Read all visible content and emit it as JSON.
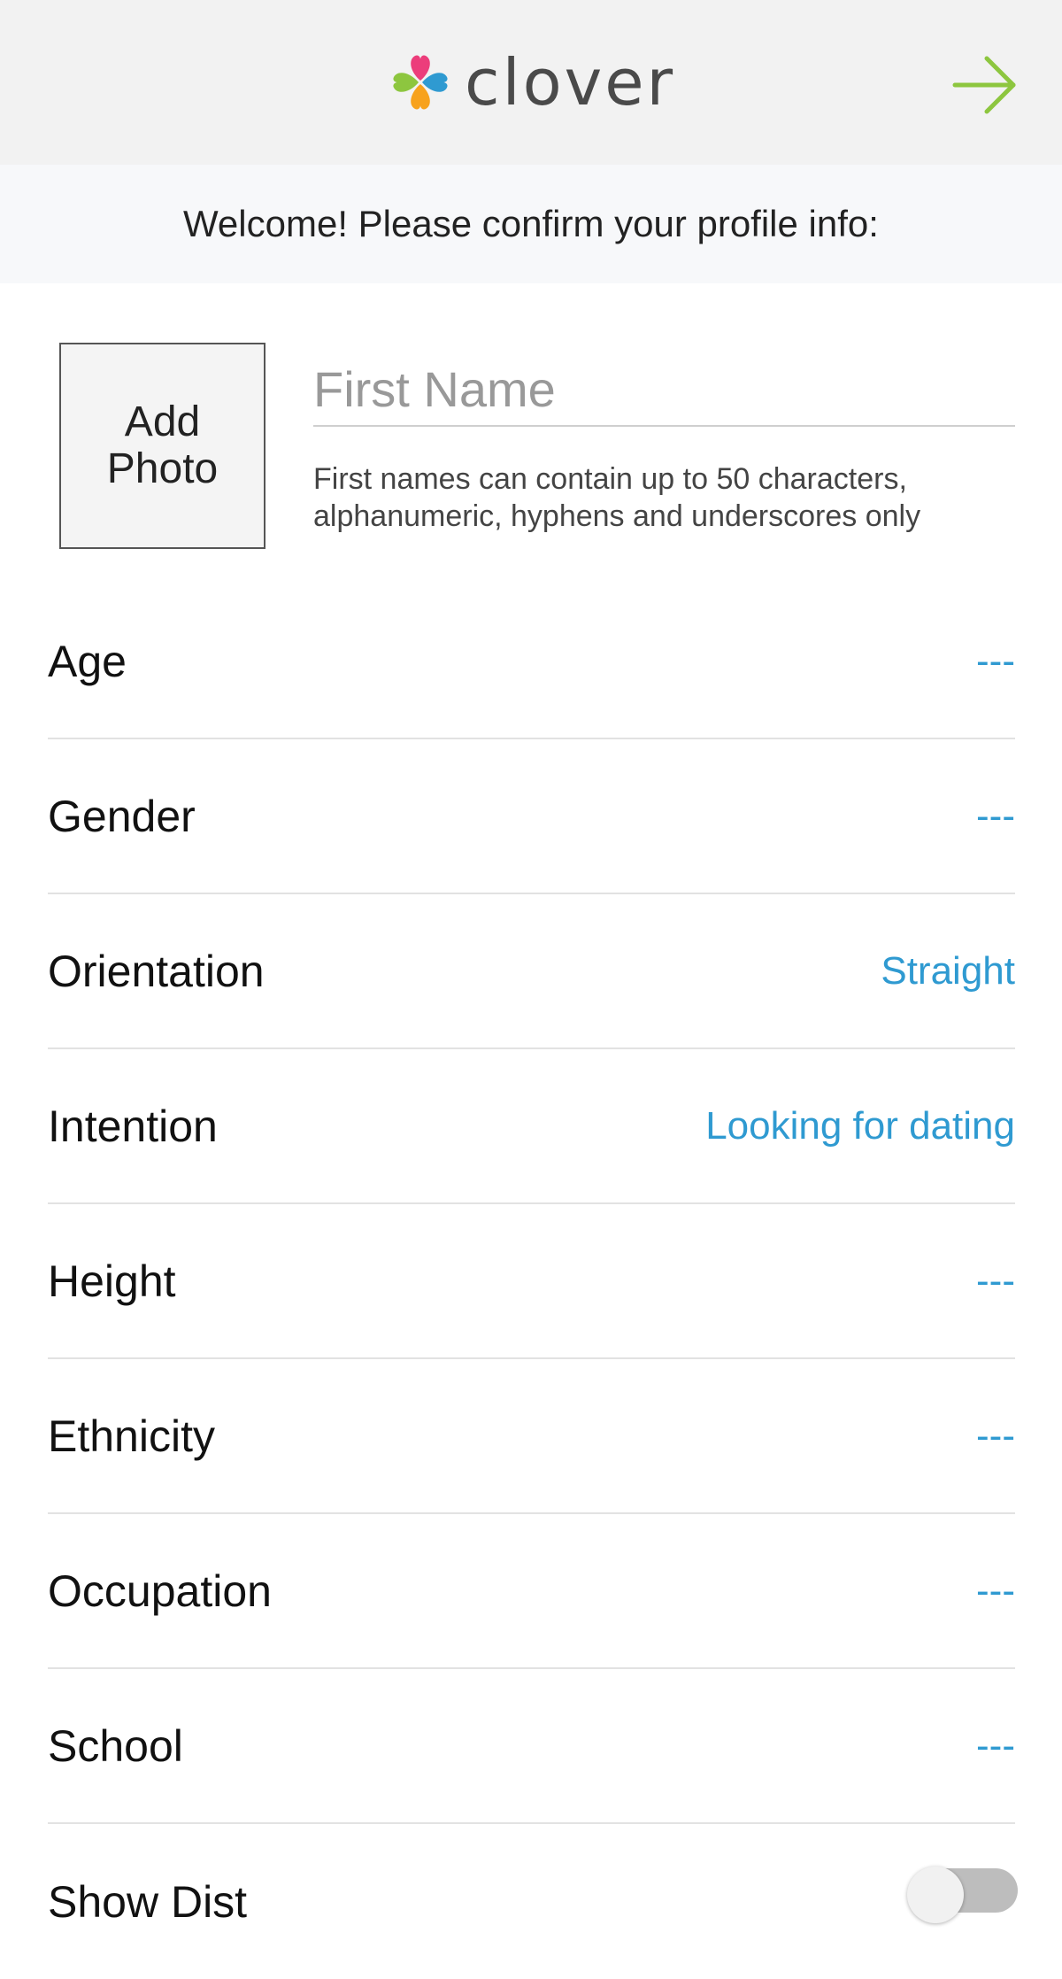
{
  "header": {
    "logo_text": "clover",
    "next_icon": "arrow-right-icon",
    "accent_color": "#8dc63f"
  },
  "welcome": {
    "text": "Welcome! Please confirm your profile info:"
  },
  "photo": {
    "label_line1": "Add",
    "label_line2": "Photo"
  },
  "name": {
    "placeholder": "First Name",
    "value": "",
    "helper_line1": "First names can contain up to 50 characters,",
    "helper_line2": "alphanumeric, hyphens and underscores only"
  },
  "fields": [
    {
      "label": "Age",
      "value": "---"
    },
    {
      "label": "Gender",
      "value": "---"
    },
    {
      "label": "Orientation",
      "value": "Straight"
    },
    {
      "label": "Intention",
      "value": "Looking for dating"
    },
    {
      "label": "Height",
      "value": "---"
    },
    {
      "label": "Ethnicity",
      "value": "---"
    },
    {
      "label": "Occupation",
      "value": "---"
    },
    {
      "label": "School",
      "value": "---"
    },
    {
      "label": "Show Dist",
      "value": ""
    }
  ],
  "colors": {
    "value_blue": "#2f9ad1",
    "header_bg": "#f2f2f2"
  }
}
